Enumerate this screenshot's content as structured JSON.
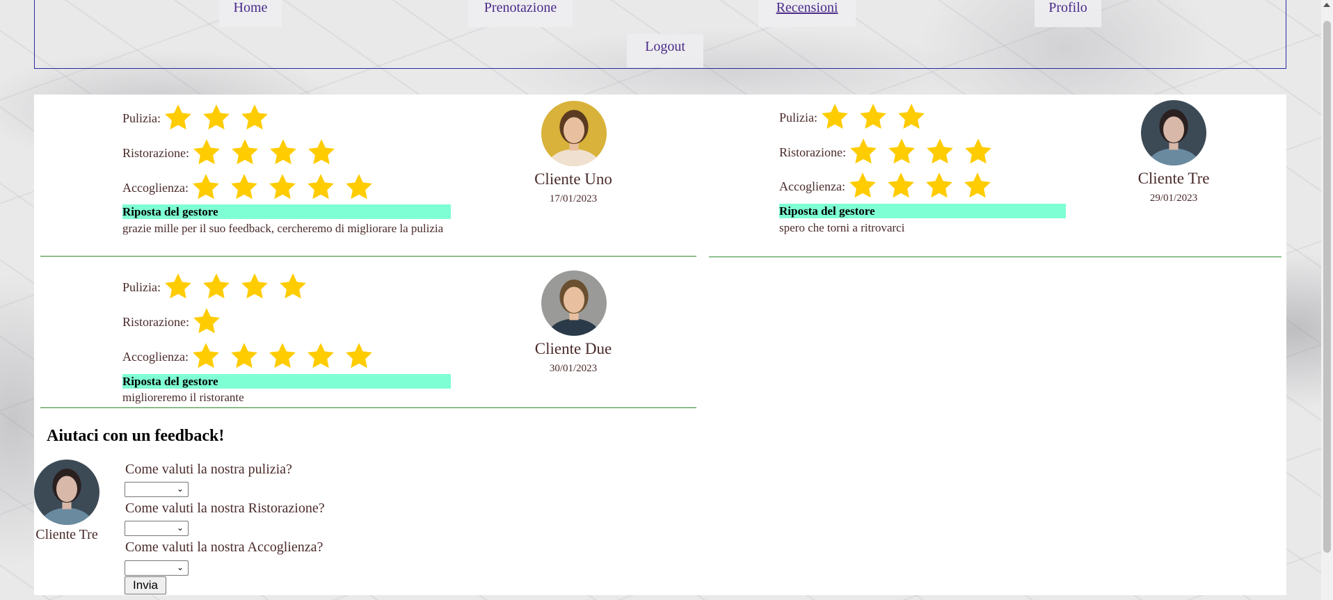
{
  "nav": {
    "items": [
      {
        "label": "Home"
      },
      {
        "label": "Prenotazione"
      },
      {
        "label": "Recensioni"
      },
      {
        "label": "Profilo"
      },
      {
        "label": "Logout"
      }
    ],
    "active": "Recensioni"
  },
  "labels": {
    "pulizia": "Pulizia:",
    "ristorazione": "Ristorazione:",
    "accoglienza": "Accoglienza:",
    "reply_head": "Riposta del gestore"
  },
  "reviews": [
    {
      "client": "Cliente Uno",
      "date": "17/01/2023",
      "pulizia": 3,
      "ristorazione": 4,
      "accoglienza": 5,
      "reply": "grazie mille per il suo feedback, cercheremo di migliorare la pulizia",
      "avatar_color": "#d8b23a"
    },
    {
      "client": "Cliente Tre",
      "date": "29/01/2023",
      "pulizia": 3,
      "ristorazione": 4,
      "accoglienza": 4,
      "reply": "spero che torni a ritrovarci",
      "avatar_color": "#3c4a56"
    },
    {
      "client": "Cliente Due",
      "date": "30/01/2023",
      "pulizia": 4,
      "ristorazione": 1,
      "accoglienza": 5,
      "reply": "miglioreremo il ristorante",
      "avatar_color": "#9a9a98"
    }
  ],
  "feedback": {
    "title": "Aiutaci con un feedback!",
    "user": "Cliente Tre",
    "q1": "Come valuti la nostra pulizia?",
    "q2": "Come valuti la nostra Ristorazione?",
    "q3": "Come valuti la nostra Accoglienza?",
    "select_value": "",
    "submit": "Invia"
  },
  "colors": {
    "star": "#ffcc00",
    "reply_bg": "#7fffd4",
    "divider": "#2e8b2e",
    "nav_border": "#2a2aa0"
  }
}
